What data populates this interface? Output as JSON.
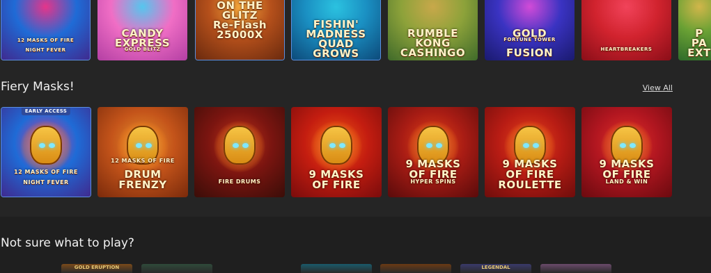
{
  "top_row": [
    {
      "title_lines": [
        "12 MASKS OF FIRE",
        "NIGHT FEVER"
      ],
      "colors": [
        "#3f2a8f",
        "#1f6bd6",
        "#e5358a"
      ]
    },
    {
      "title_lines": [
        "CANDY",
        "EXPRESS",
        "GOLD BLITZ"
      ],
      "colors": [
        "#b33fa3",
        "#f06ec5",
        "#55c6ee"
      ]
    },
    {
      "title_lines": [
        "ON THE",
        "GLITZ",
        "Re-Flash",
        "25000X"
      ],
      "colors": [
        "#6a2a0e",
        "#b5501b",
        "#f4a63b"
      ]
    },
    {
      "title_lines": [
        "FISHIN'",
        "MADNESS",
        "QUAD",
        "GROWS"
      ],
      "colors": [
        "#0d4a7a",
        "#1a8fc2",
        "#2bc2e0"
      ]
    },
    {
      "title_lines": [
        "RUMBLE",
        "KONG",
        "CASHINGO"
      ],
      "colors": [
        "#3f6a2a",
        "#8da23a",
        "#c8a84a"
      ]
    },
    {
      "title_lines": [
        "GOLD",
        "FORTUNE TOWER",
        "FUSION"
      ],
      "colors": [
        "#1a1a6e",
        "#3a33c2",
        "#d14bd8"
      ]
    },
    {
      "title_lines": [
        "HEARTBREAKERS"
      ],
      "colors": [
        "#8a0e18",
        "#d1232e",
        "#f1435a"
      ]
    },
    {
      "title_lines": [
        "P",
        "PA",
        "EXT"
      ],
      "colors": [
        "#2f6b2a",
        "#6aa134",
        "#d1b64a"
      ]
    }
  ],
  "section": {
    "title": "Fiery Masks!",
    "view_all": "View All",
    "games": [
      {
        "badge": "EARLY ACCESS",
        "title_lines": [
          "12 MASKS OF FIRE",
          "NIGHT FEVER"
        ],
        "colors": [
          "#3f2a8f",
          "#1f6bd6",
          "#e5358a"
        ]
      },
      {
        "badge": "",
        "title_lines": [
          "12 MASKS OF FIRE",
          "DRUM",
          "FRENZY"
        ],
        "colors": [
          "#7a2a0b",
          "#c4541a",
          "#e5902c"
        ]
      },
      {
        "badge": "",
        "title_lines": [
          "FIRE DRUMS"
        ],
        "colors": [
          "#3a0d08",
          "#7b1510",
          "#c23219"
        ]
      },
      {
        "badge": "",
        "title_lines": [
          "9 MASKS",
          "OF FIRE"
        ],
        "colors": [
          "#7a0c0c",
          "#c41d10",
          "#ef5a14"
        ]
      },
      {
        "badge": "",
        "title_lines": [
          "9 MASKS",
          "OF FIRE",
          "HYPER SPINS"
        ],
        "colors": [
          "#5a0b0b",
          "#a81c14",
          "#e44217"
        ]
      },
      {
        "badge": "",
        "title_lines": [
          "9 MASKS",
          "OF FIRE",
          "ROULETTE"
        ],
        "colors": [
          "#6e0d0b",
          "#b81c14",
          "#e7441a"
        ]
      },
      {
        "badge": "",
        "title_lines": [
          "9 MASKS",
          "OF FIRE",
          "LAND & WIN"
        ],
        "colors": [
          "#6b0a0f",
          "#b11620",
          "#e43128"
        ]
      }
    ]
  },
  "next_section": {
    "title": "Not sure what to play?",
    "peek_labels": [
      "GOLD ERUPTION",
      "LEGENDAL"
    ]
  }
}
